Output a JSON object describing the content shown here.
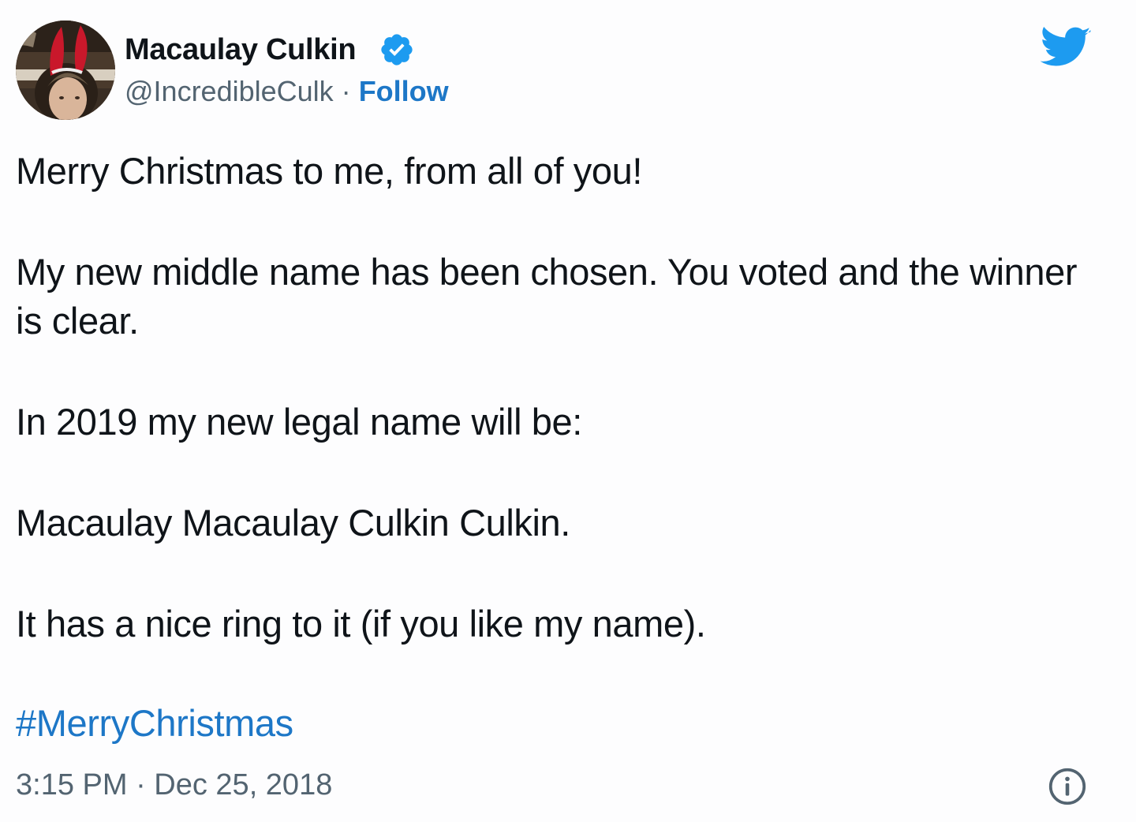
{
  "author": {
    "display_name": "Macaulay Culkin",
    "handle": "@IncredibleCulk",
    "separator": "·",
    "follow_label": "Follow",
    "verified": true
  },
  "icons": {
    "avatar": "profile-photo",
    "verified": "verified-badge-icon",
    "brand": "twitter-bird-icon",
    "info": "info-circle-icon"
  },
  "tweet": {
    "paragraphs": [
      "Merry Christmas to me, from all of you!",
      "My new middle name has been chosen. You voted and the winner is clear.",
      "In 2019 my new legal name will be:",
      "Macaulay Macaulay Culkin Culkin.",
      "It has a nice ring to it (if you like my name)."
    ],
    "hashtag": "#MerryChristmas",
    "timestamp": "3:15 PM · Dec 25, 2018"
  },
  "colors": {
    "text": "#0f1419",
    "secondary": "#536471",
    "link": "#1d77c7",
    "twitter_blue": "#1d9bf0"
  }
}
